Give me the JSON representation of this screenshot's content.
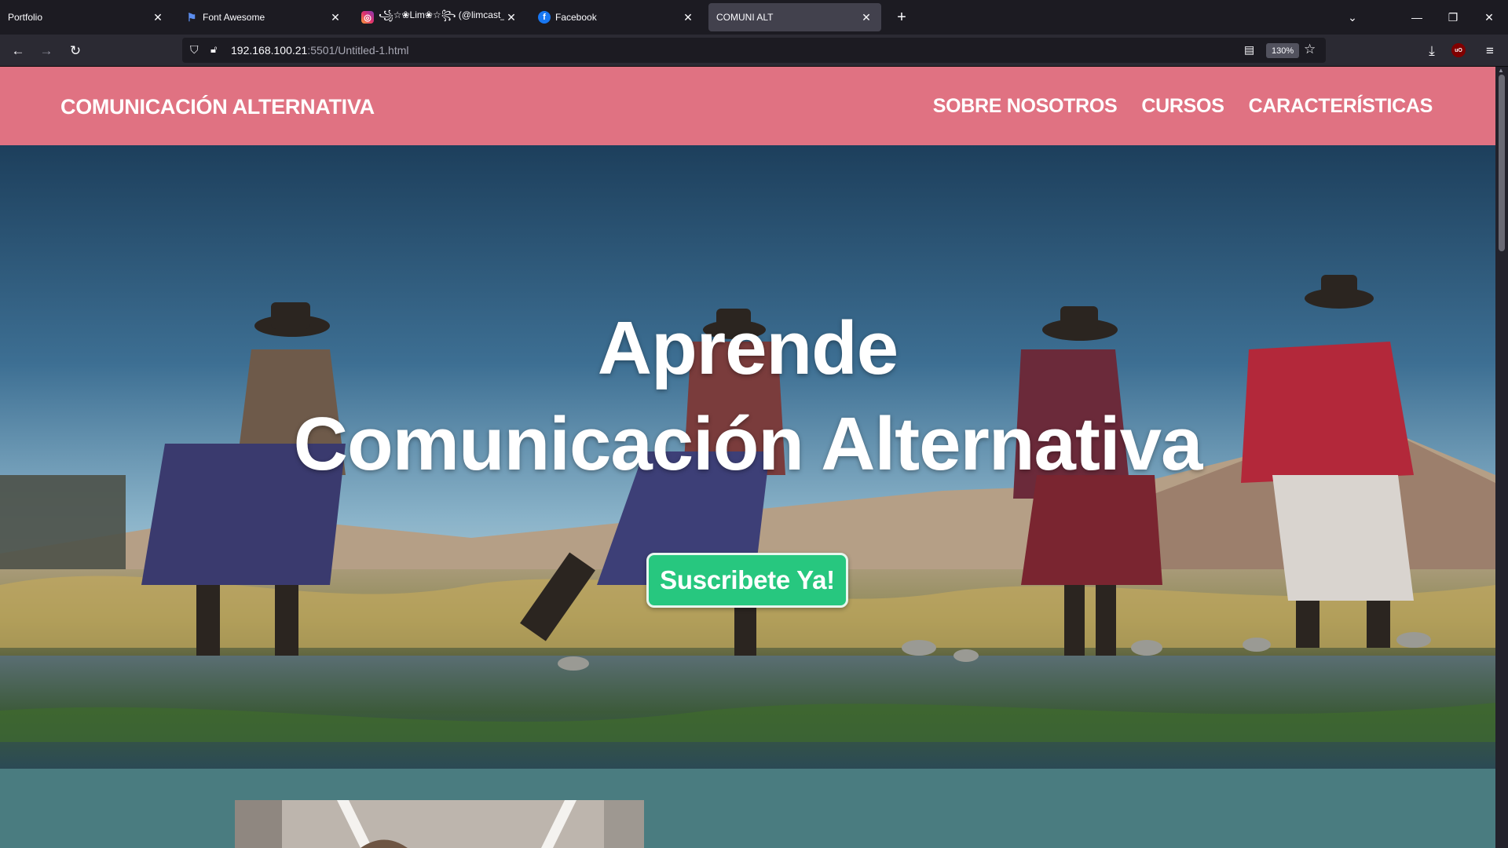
{
  "browser": {
    "tabs": [
      {
        "title": "Portfolio",
        "icon": "none",
        "active": false
      },
      {
        "title": "Font Awesome",
        "icon": "flag-icon",
        "active": false
      },
      {
        "title": "꧁☆❀Lim❀☆꧂ (@limcast_)",
        "icon": "instagram-icon",
        "active": false
      },
      {
        "title": "Facebook",
        "icon": "facebook-icon",
        "active": false
      },
      {
        "title": "COMUNI ALT",
        "icon": "none",
        "active": true
      }
    ],
    "url_host": "192.168.100.21",
    "url_path": ":5501/Untitled-1.html",
    "zoom": "130%"
  },
  "site": {
    "brand": "COMUNICACIÓN ALTERNATIVA",
    "menu": [
      "SOBRE NOSOTROS",
      "CURSOS",
      "CARACTERÍSTICAS"
    ],
    "hero_title_line1": "Aprende",
    "hero_title_line2": "Comunicación Alternativa",
    "cta_label": "Suscribete Ya!"
  },
  "colors": {
    "header_bg": "#e07282",
    "cta_bg": "#27c77f",
    "section_bg": "#4a7c80"
  }
}
